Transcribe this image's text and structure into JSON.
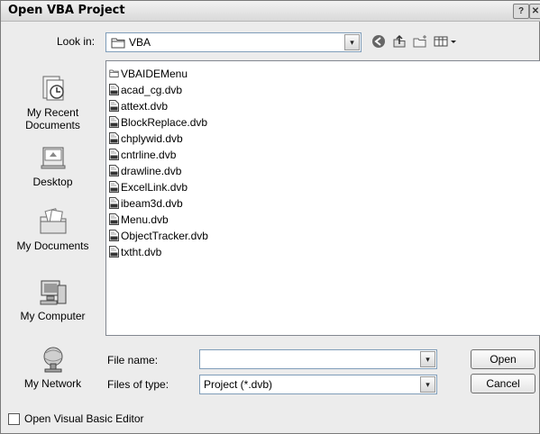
{
  "window": {
    "title": "Open VBA Project",
    "help_glyph": "?",
    "close_glyph": "✕"
  },
  "look_in": {
    "label": "Look in:",
    "value": "VBA",
    "dropdown_glyph": "▾"
  },
  "toolbar": {
    "back_icon": "back-icon",
    "up_icon": "up-folder-icon",
    "new_folder_icon": "new-folder-icon",
    "views_icon": "views-menu-icon"
  },
  "places": [
    {
      "label": "My Recent\nDocuments",
      "icon": "recent-documents-icon"
    },
    {
      "label": "Desktop",
      "icon": "desktop-icon"
    },
    {
      "label": "My Documents",
      "icon": "my-documents-icon"
    },
    {
      "label": "My Computer",
      "icon": "my-computer-icon"
    },
    {
      "label": "My Network",
      "icon": "my-network-icon"
    }
  ],
  "files": [
    {
      "name": "VBAIDEMenu",
      "kind": "folder"
    },
    {
      "name": "acad_cg.dvb",
      "kind": "dvb"
    },
    {
      "name": "attext.dvb",
      "kind": "dvb"
    },
    {
      "name": "BlockReplace.dvb",
      "kind": "dvb"
    },
    {
      "name": "chplywid.dvb",
      "kind": "dvb"
    },
    {
      "name": "cntrline.dvb",
      "kind": "dvb"
    },
    {
      "name": "drawline.dvb",
      "kind": "dvb"
    },
    {
      "name": "ExcelLink.dvb",
      "kind": "dvb"
    },
    {
      "name": "ibeam3d.dvb",
      "kind": "dvb"
    },
    {
      "name": "Menu.dvb",
      "kind": "dvb"
    },
    {
      "name": "ObjectTracker.dvb",
      "kind": "dvb"
    },
    {
      "name": "txtht.dvb",
      "kind": "dvb"
    }
  ],
  "file_name": {
    "label": "File name:",
    "value": ""
  },
  "files_of_type": {
    "label": "Files of type:",
    "value": "Project (*.dvb)"
  },
  "buttons": {
    "open": "Open",
    "cancel": "Cancel"
  },
  "checkbox": {
    "label": "Open Visual Basic Editor",
    "checked": false
  }
}
